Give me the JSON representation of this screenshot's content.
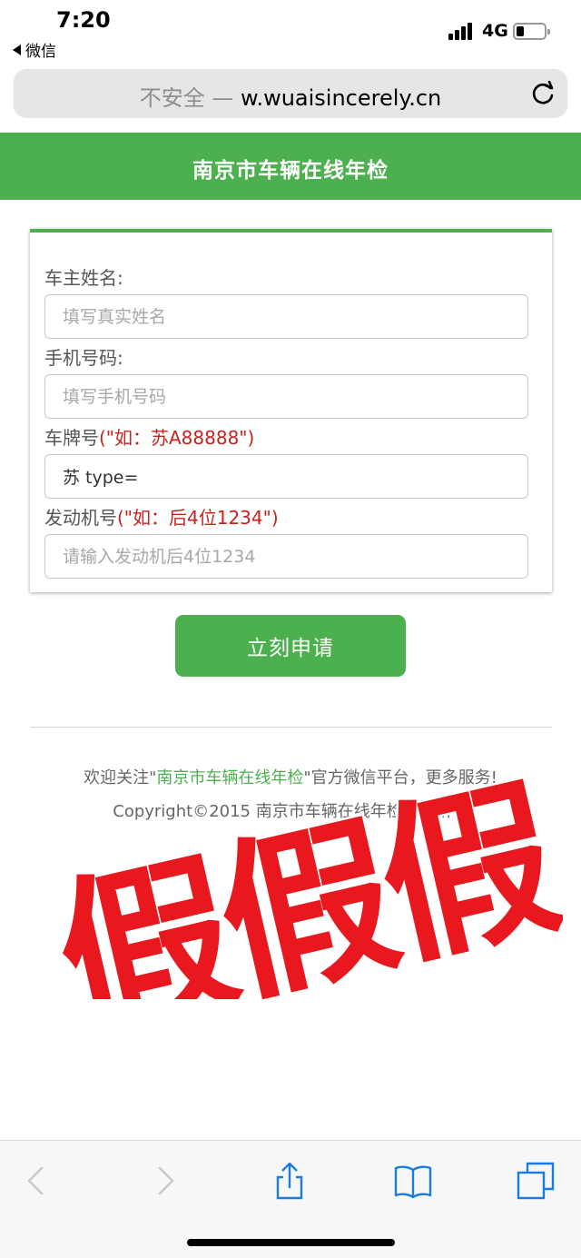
{
  "status_bar": {
    "time": "7:20",
    "back_app": "微信",
    "network": "4G"
  },
  "browser": {
    "insecure_label": "不安全 —",
    "domain": "w.wuaisincerely.cn"
  },
  "header": {
    "title": "南京市车辆在线年检"
  },
  "form": {
    "owner_name": {
      "label": "车主姓名:",
      "placeholder": "填写真实姓名",
      "value": ""
    },
    "phone": {
      "label": "手机号码:",
      "placeholder": "填写手机号码",
      "value": ""
    },
    "plate": {
      "label": "车牌号",
      "hint": "(\"如：苏A88888\")",
      "value": "苏 type="
    },
    "engine": {
      "label": "发动机号",
      "hint": "(\"如：后4位1234\")",
      "placeholder": "请输入发动机后4位1234",
      "value": ""
    },
    "submit_label": "立刻申请"
  },
  "footer": {
    "follow_prefix": "欢迎关注\"",
    "follow_brand": "南京市车辆在线年检",
    "follow_suffix": "\"官方微信平台，更多服务!",
    "copyright": "Copyright©2015 南京市车辆在线年检版权所有"
  },
  "stamp": {
    "text": "假假假",
    "color": "#e8181e"
  },
  "colors": {
    "accent": "#4db04f",
    "hint": "#c5241d",
    "browser_blue": "#1a7ce0"
  }
}
